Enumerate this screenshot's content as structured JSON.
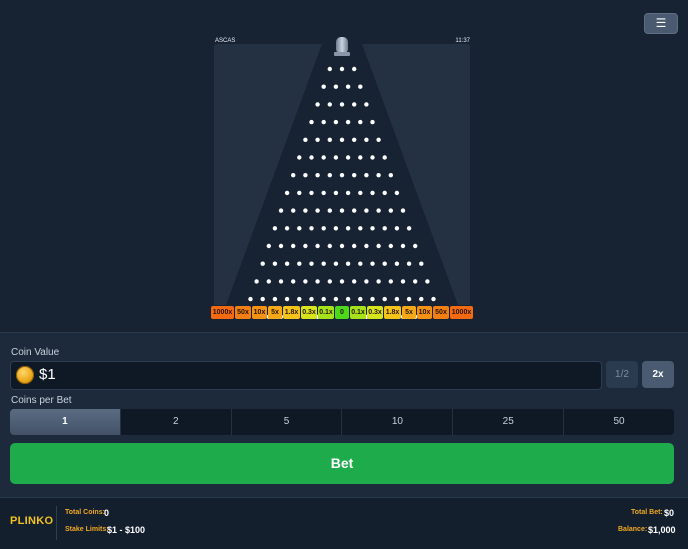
{
  "menu": {
    "icon": "menu-icon",
    "glyph": "☰"
  },
  "board": {
    "label_left": "ASCAS",
    "label_right": "11:37",
    "rows": 16,
    "slots": [
      {
        "label": "1000x",
        "color": "#f46a12"
      },
      {
        "label": "50x",
        "color": "#f27f14"
      },
      {
        "label": "10x",
        "color": "#f49216"
      },
      {
        "label": "5x",
        "color": "#f6a918"
      },
      {
        "label": "1.8x",
        "color": "#f4c41a"
      },
      {
        "label": "0.3x",
        "color": "#d8e51c"
      },
      {
        "label": "0.1x",
        "color": "#a6e21c"
      },
      {
        "label": "0",
        "color": "#4ed81a"
      },
      {
        "label": "0.1x",
        "color": "#a6e21c"
      },
      {
        "label": "0.3x",
        "color": "#d8e51c"
      },
      {
        "label": "1.8x",
        "color": "#f4c41a"
      },
      {
        "label": "5x",
        "color": "#f6a918"
      },
      {
        "label": "10x",
        "color": "#f49216"
      },
      {
        "label": "50x",
        "color": "#f27f14"
      },
      {
        "label": "1000x",
        "color": "#f46a12"
      }
    ]
  },
  "coin_value": {
    "label": "Coin Value",
    "value": "$1",
    "icon": "coin-icon",
    "half_label": "1/2",
    "double_label": "2x"
  },
  "coins_per_bet": {
    "label": "Coins per Bet",
    "options": [
      "1",
      "2",
      "5",
      "10",
      "25",
      "50"
    ],
    "selected": "1"
  },
  "bet_button": {
    "label": "Bet"
  },
  "footer": {
    "logo": "PLINKO",
    "total_coins_label": "Total Coins:",
    "total_coins_value": "0",
    "stake_limits_label": "Stake Limits:",
    "stake_limits_value": "$1 - $100",
    "total_bet_label": "Total Bet:",
    "total_bet_value": "$0",
    "balance_label": "Balance:",
    "balance_value": "$1,000"
  },
  "colors": {
    "accent_green": "#1eab4c",
    "footer_label": "#f0a822",
    "logo": "#f2c21b"
  }
}
